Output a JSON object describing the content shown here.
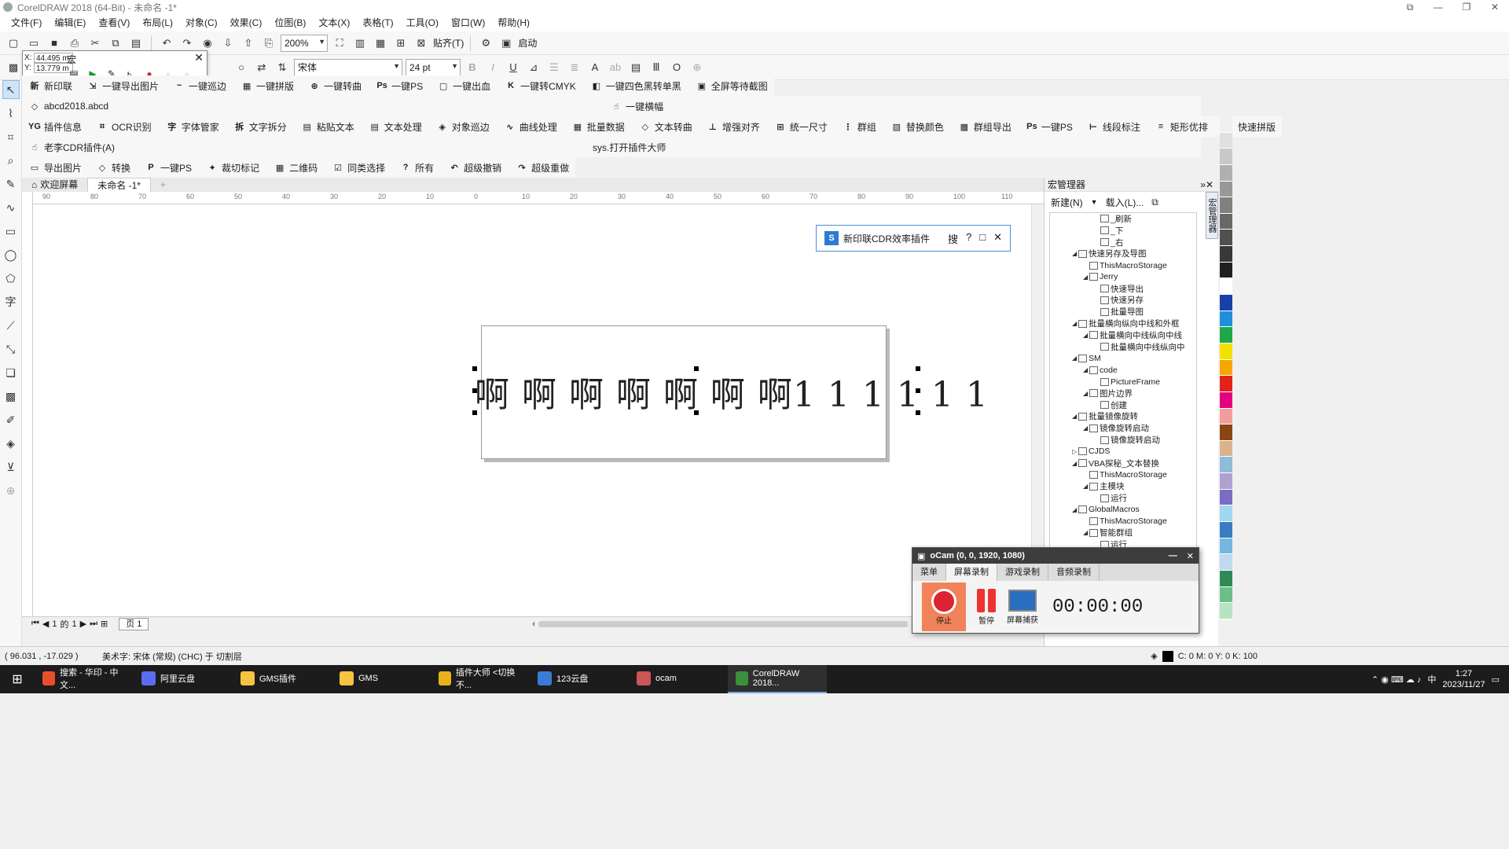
{
  "window": {
    "title": "CorelDRAW 2018 (64-Bit) - 未命名 -1*"
  },
  "menu": [
    "文件(F)",
    "编辑(E)",
    "查看(V)",
    "布局(L)",
    "对象(C)",
    "效果(C)",
    "位图(B)",
    "文本(X)",
    "表格(T)",
    "工具(O)",
    "窗口(W)",
    "帮助(H)"
  ],
  "toolbar": {
    "zoom": "200%",
    "snap_label": "贴齐(T)",
    "launch_label": "启动"
  },
  "propbar": {
    "font_name": "宋体",
    "font_size": "24 pt",
    "x_value": "44.495 m",
    "y_value": "13.779 m"
  },
  "macro_popup": {
    "title": "宏"
  },
  "plugin_row1": [
    {
      "icon": "新",
      "label": "新印联"
    },
    {
      "icon": "⇲",
      "label": "一键导出图片"
    },
    {
      "icon": "~",
      "label": "一键巡边"
    },
    {
      "icon": "▦",
      "label": "一键拼版"
    },
    {
      "icon": "⊕",
      "label": "一键转曲"
    },
    {
      "icon": "Ps",
      "label": "一键PS"
    },
    {
      "icon": "▢",
      "label": "一键出血"
    },
    {
      "icon": "K",
      "label": "一键转CMYK"
    },
    {
      "icon": "◧",
      "label": "一键四色黑转单黑"
    },
    {
      "icon": "▣",
      "label": "全屏等待截图"
    }
  ],
  "plugin_row2": {
    "file": "abcd2018.abcd",
    "right_label": "一键横幅"
  },
  "plugin_row3": [
    {
      "icon": "YG",
      "label": "插件信息"
    },
    {
      "icon": "⌗",
      "label": "OCR识别"
    },
    {
      "icon": "字",
      "label": "字体管家"
    },
    {
      "icon": "拆",
      "label": "文字拆分"
    },
    {
      "icon": "▤",
      "label": "粘贴文本"
    },
    {
      "icon": "▤",
      "label": "文本处理"
    },
    {
      "icon": "◈",
      "label": "对象巡边"
    },
    {
      "icon": "∿",
      "label": "曲线处理"
    },
    {
      "icon": "▦",
      "label": "批量数据"
    },
    {
      "icon": "◇",
      "label": "文本转曲"
    },
    {
      "icon": "⊥",
      "label": "增强对齐"
    },
    {
      "icon": "⊞",
      "label": "统一尺寸"
    },
    {
      "icon": "⋮",
      "label": "群组"
    },
    {
      "icon": "▨",
      "label": "替换颜色"
    },
    {
      "icon": "▩",
      "label": "群组导出"
    },
    {
      "icon": "Ps",
      "label": "一键PS"
    },
    {
      "icon": "⊢",
      "label": "线段标注"
    },
    {
      "icon": "≡",
      "label": "矩形优排"
    },
    {
      "icon": "▥",
      "label": "快速拼版"
    }
  ],
  "plugin_row4": {
    "left": "老李CDR插件(A)",
    "right": "sys.打开插件大师"
  },
  "plugin_row5": [
    {
      "icon": "▭",
      "label": "导出图片"
    },
    {
      "icon": "◇",
      "label": "转换"
    },
    {
      "icon": "P",
      "label": "一键PS"
    },
    {
      "icon": "✦",
      "label": "裁切标记"
    },
    {
      "icon": "▦",
      "label": "二维码"
    },
    {
      "icon": "☑",
      "label": "同类选择"
    },
    {
      "icon": "?",
      "label": "所有"
    },
    {
      "icon": "↶",
      "label": "超级撤销"
    },
    {
      "icon": "↷",
      "label": "超级重做"
    }
  ],
  "doc_tabs": [
    "欢迎屏幕",
    "未命名 -1*"
  ],
  "ruler_ticks": [
    "90",
    "80",
    "70",
    "60",
    "50",
    "40",
    "30",
    "20",
    "10",
    "0",
    "10",
    "20",
    "30",
    "40",
    "50",
    "60",
    "70",
    "80",
    "90",
    "100",
    "110"
  ],
  "canvas": {
    "text": "啊 啊 啊 啊 啊 啊 啊1 1 1 1 1 1"
  },
  "page_nav": {
    "current": "1",
    "of_label": "的",
    "total": "1",
    "page_tab": "页 1"
  },
  "cdr_plugin": {
    "title": "新印联CDR效率插件",
    "search": "搜",
    "help": "?",
    "max": "□",
    "close": "✕"
  },
  "docker": {
    "title": "宏管理器",
    "new_label": "新建(N)",
    "load_label": "载入(L)...",
    "side_tab": "宏管理器",
    "tree": [
      {
        "depth": 4,
        "label": "_刷新",
        "tw": ""
      },
      {
        "depth": 4,
        "label": "_下",
        "tw": ""
      },
      {
        "depth": 4,
        "label": "_右",
        "tw": ""
      },
      {
        "depth": 2,
        "label": "快速另存及导图",
        "tw": "◢"
      },
      {
        "depth": 3,
        "label": "ThisMacroStorage",
        "tw": ""
      },
      {
        "depth": 3,
        "label": "Jerry",
        "tw": "◢"
      },
      {
        "depth": 4,
        "label": "快速导出",
        "tw": ""
      },
      {
        "depth": 4,
        "label": "快速另存",
        "tw": ""
      },
      {
        "depth": 4,
        "label": "批量导图",
        "tw": ""
      },
      {
        "depth": 2,
        "label": "批量横向纵向中线和外框",
        "tw": "◢"
      },
      {
        "depth": 3,
        "label": "批量横向中线纵向中线",
        "tw": "◢"
      },
      {
        "depth": 4,
        "label": "批量横向中线纵向中",
        "tw": ""
      },
      {
        "depth": 2,
        "label": "SM",
        "tw": "◢"
      },
      {
        "depth": 3,
        "label": "code",
        "tw": "◢"
      },
      {
        "depth": 4,
        "label": "PictureFrame",
        "tw": ""
      },
      {
        "depth": 3,
        "label": "图片边界",
        "tw": "◢"
      },
      {
        "depth": 4,
        "label": "创建",
        "tw": ""
      },
      {
        "depth": 2,
        "label": "批量镜像旋转",
        "tw": "◢"
      },
      {
        "depth": 3,
        "label": "镜像旋转启动",
        "tw": "◢"
      },
      {
        "depth": 4,
        "label": "镜像旋转启动",
        "tw": ""
      },
      {
        "depth": 2,
        "label": "CJDS",
        "tw": "▷"
      },
      {
        "depth": 2,
        "label": "VBA探秘_文本替换",
        "tw": "◢"
      },
      {
        "depth": 3,
        "label": "ThisMacroStorage",
        "tw": ""
      },
      {
        "depth": 3,
        "label": "主模块",
        "tw": "◢"
      },
      {
        "depth": 4,
        "label": "运行",
        "tw": ""
      },
      {
        "depth": 2,
        "label": "GlobalMacros",
        "tw": "◢"
      },
      {
        "depth": 3,
        "label": "ThisMacroStorage",
        "tw": ""
      },
      {
        "depth": 3,
        "label": "智能群组",
        "tw": "◢"
      },
      {
        "depth": 4,
        "label": "运行",
        "tw": ""
      }
    ]
  },
  "palette": [
    "#f0f0f0",
    "#e0e0e0",
    "#c8c8c8",
    "#b0b0b0",
    "#989898",
    "#808080",
    "#686868",
    "#505050",
    "#383838",
    "#202020",
    "#ffffff",
    "#1a3fa8",
    "#1f8fd8",
    "#1fa84a",
    "#f2e200",
    "#f7a600",
    "#e2231a",
    "#e4007f",
    "#f39c9c",
    "#8b4513",
    "#d9b38c",
    "#8fbcd8",
    "#b0a0d0",
    "#7c6cc4",
    "#a0d8ef",
    "#3a7cc4",
    "#76b7e0",
    "#c0d8f0",
    "#2e8b57",
    "#6bbf8a",
    "#b6e3c2"
  ],
  "ocam": {
    "title": "oCam (0, 0, 1920, 1080)",
    "tabs": [
      "菜单",
      "屏幕录制",
      "游戏录制",
      "音频录制"
    ],
    "stop": "停止",
    "pause": "暂停",
    "capture": "屏幕捕获",
    "time": "00:00:00"
  },
  "status": {
    "coords": "( 96.031 , -17.029 )",
    "info": "美术字: 宋体 (常规) (CHC) 于 切割层",
    "color": "C: 0 M: 0 Y: 0 K: 100"
  },
  "taskbar": {
    "items": [
      {
        "label": "搜索 - 华印 - 中文...",
        "color": "#e94e2b"
      },
      {
        "label": "阿里云盘",
        "color": "#5b6cf0"
      },
      {
        "label": "GMS插件",
        "color": "#f5c542"
      },
      {
        "label": "GMS",
        "color": "#f5c542"
      },
      {
        "label": "插件大师 <切换不...",
        "color": "#e8b31a"
      },
      {
        "label": "123云盘",
        "color": "#3a7bd5"
      },
      {
        "label": "ocam",
        "color": "#c55"
      },
      {
        "label": "CorelDRAW 2018...",
        "color": "#3b8e3b"
      }
    ],
    "ime": "中",
    "time": "1:27",
    "date": "2023/11/27"
  }
}
